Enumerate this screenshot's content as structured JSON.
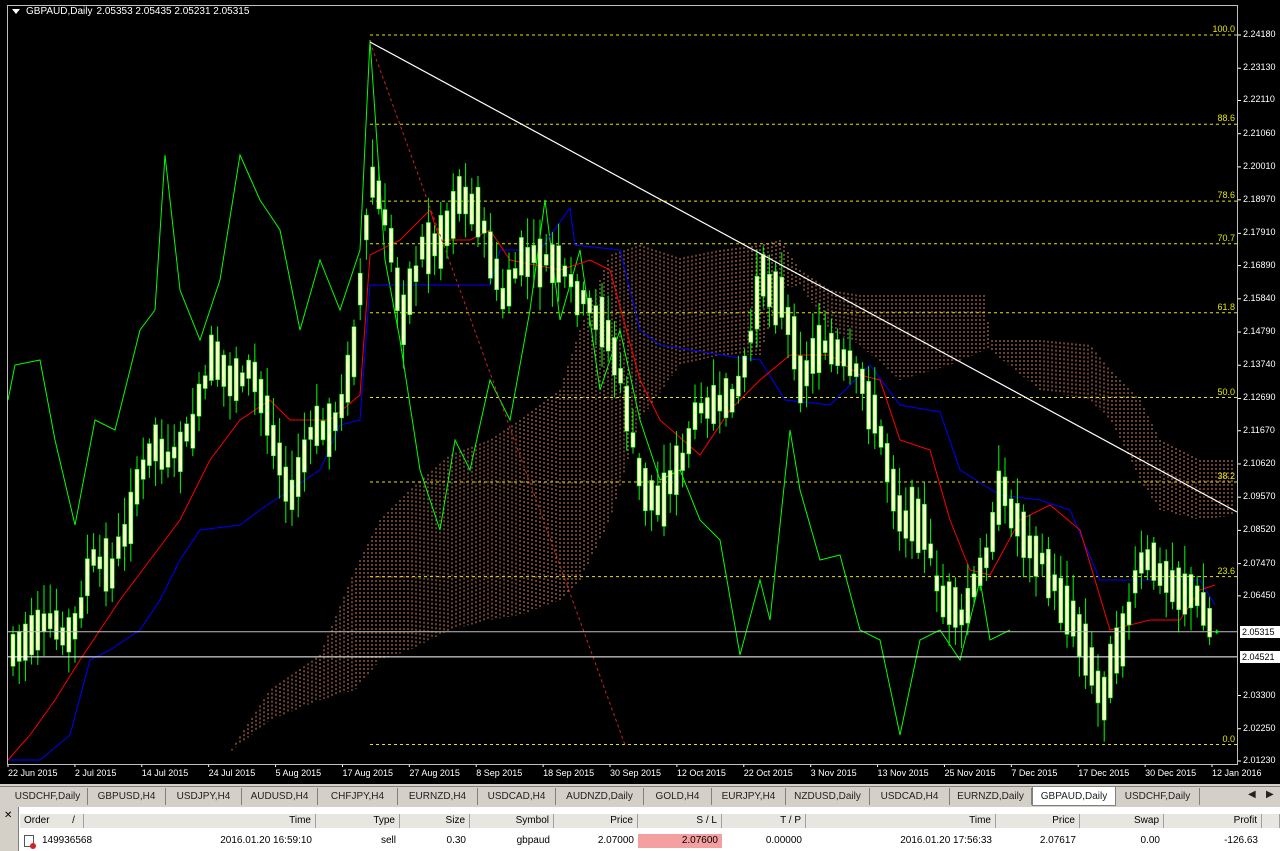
{
  "chart": {
    "title": "GBPAUD,Daily",
    "ohlc": "2.05353 2.05435 2.05231 2.05315",
    "colors": {
      "background": "#000000",
      "candle_body": "#ffffcc",
      "candle_wick": "#00ff00",
      "kijun": "#0000ff",
      "tenkan": "#ff0000",
      "chikou": "#00ff00",
      "cloud": "#ff9966",
      "fib": "#e6e600",
      "trendline": "#ffffff"
    },
    "price_axis": [
      "2.24180",
      "2.23130",
      "2.22110",
      "2.21060",
      "2.20010",
      "2.18970",
      "2.17910",
      "2.16890",
      "2.15840",
      "2.14790",
      "2.13740",
      "2.12690",
      "2.11670",
      "2.10620",
      "2.09570",
      "2.08520",
      "2.07470",
      "2.06450",
      "2.05315",
      "2.04521",
      "2.03300",
      "2.02250",
      "2.01230"
    ],
    "price_axis_values": [
      2.2418,
      2.2313,
      2.2211,
      2.2106,
      2.2001,
      2.1897,
      2.1791,
      2.1689,
      2.1584,
      2.1479,
      2.1374,
      2.1269,
      2.1167,
      2.1062,
      2.0957,
      2.0852,
      2.0747,
      2.0645,
      2.05315,
      2.04521,
      2.033,
      2.0225,
      2.0123
    ],
    "current_price": "2.05315",
    "bid_line_price": "2.04521",
    "date_axis": [
      "22 Jun 2015",
      "2 Jul 2015",
      "14 Jul 2015",
      "24 Jul 2015",
      "5 Aug 2015",
      "17 Aug 2015",
      "27 Aug 2015",
      "8 Sep 2015",
      "18 Sep 2015",
      "30 Sep 2015",
      "12 Oct 2015",
      "22 Oct 2015",
      "3 Nov 2015",
      "13 Nov 2015",
      "25 Nov 2015",
      "7 Dec 2015",
      "17 Dec 2015",
      "30 Dec 2015",
      "12 Jan 2016"
    ],
    "fib_levels": [
      {
        "label": "100.0",
        "price": 2.2418
      },
      {
        "label": "88.6",
        "price": 2.2136
      },
      {
        "label": "78.6",
        "price": 2.1893
      },
      {
        "label": "70.7",
        "price": 2.1758
      },
      {
        "label": "61.8",
        "price": 2.154
      },
      {
        "label": "50.0",
        "price": 2.1272
      },
      {
        "label": "38.2",
        "price": 2.1005
      },
      {
        "label": "23.6",
        "price": 2.0706
      },
      {
        "label": "0.0",
        "price": 2.0175
      }
    ]
  },
  "tabs": [
    "USDCHF,Daily",
    "GBPUSD,H4",
    "USDJPY,H4",
    "AUDUSD,H4",
    "CHFJPY,H4",
    "EURNZD,H4",
    "USDCAD,H4",
    "AUDNZD,Daily",
    "GOLD,H4",
    "EURJPY,H4",
    "NZDUSD,Daily",
    "USDCAD,H4",
    "EURNZD,Daily",
    "GBPAUD,Daily",
    "USDCHF,Daily"
  ],
  "active_tab": "GBPAUD,Daily",
  "terminal": {
    "columns": {
      "order": "Order",
      "sort": "/",
      "time": "Time",
      "type": "Type",
      "size": "Size",
      "symbol": "Symbol",
      "price": "Price",
      "sl": "S / L",
      "tp": "T / P",
      "close_time": "Time",
      "close_price": "Price",
      "swap": "Swap",
      "profit": "Profit"
    },
    "row": {
      "order": "149936568",
      "time": "2016.01.20 16:59:10",
      "type": "sell",
      "size": "0.30",
      "symbol": "gbpaud",
      "price": "2.07000",
      "sl": "2.07600",
      "tp": "0.00000",
      "close_time": "2016.01.20 17:56:33",
      "close_price": "2.07617",
      "swap": "0.00",
      "profit": "-126.63"
    }
  }
}
